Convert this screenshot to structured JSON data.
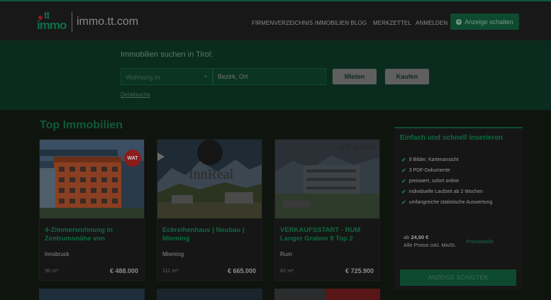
{
  "header": {
    "logo_tt": "tt",
    "logo_immo": "immo",
    "site_name": "immo.tt.com",
    "nav": [
      {
        "label": "FIRMENVERZEICHNIS"
      },
      {
        "label": "IMMOBILIEN BLOG"
      },
      {
        "label": "MERKZETTEL"
      },
      {
        "label": "ANMELDEN"
      }
    ],
    "cta_label": "Anzeige schalten"
  },
  "search": {
    "title": "Immobilien suchen in Tirol:",
    "type_select": "Wohnung m",
    "location_placeholder": "Bezirk, Ort",
    "rent_label": "Mieten",
    "buy_label": "Kaufen",
    "detail_link": "Detailsuche"
  },
  "main": {
    "section_title": "Top Immobilien",
    "listings": [
      {
        "title": "4-Zimmerwohnung in Zentrumsnähe von",
        "location": "Innsbruck",
        "area": "96 m²",
        "price": "€ 488.000",
        "badge": "WAT"
      },
      {
        "title": "Eckreihenhaus | Neubau | Mieming",
        "location": "Mieming",
        "area": "111 m²",
        "price": "€ 665.000",
        "watermark": "InnReal"
      },
      {
        "title": "VERKAUFSSTART - RUM Langer Graben 9 Top 2",
        "location": "Rum",
        "area": "82 m²",
        "price": "€ 725.900",
        "watermark": "WEIBERN"
      }
    ]
  },
  "sidebar": {
    "heading": "Einfach und schnell inserieren",
    "features": [
      "9 Bilder, Kartenansicht",
      "3 PDF-Dokumente",
      "preiswert, sofort online",
      "individuelle Laufzeit ab 2 Wochen",
      "umfangreiche statistische Auswertung"
    ],
    "price_prefix": "ab",
    "price_value": "24,90 €",
    "price_note": "Alle Preise inkl. MwSt.",
    "price_table_link": "Preistabelle",
    "cta_label": "ANZEIGE SCHALTEN"
  },
  "colors": {
    "brand_green": "#0e5a38",
    "hero_bg": "#0a2c1e",
    "badge_red": "#8b1c1c"
  }
}
